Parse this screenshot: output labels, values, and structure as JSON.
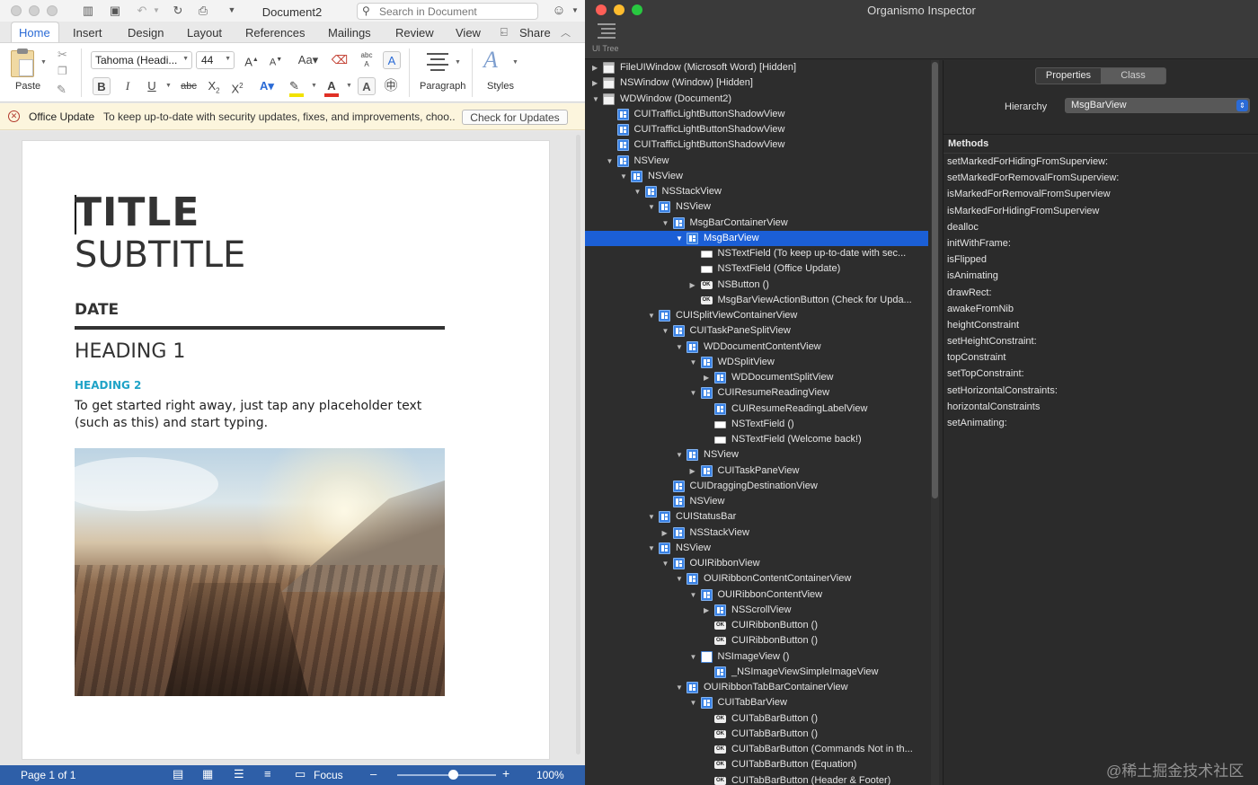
{
  "word": {
    "document_title": "Document2",
    "search_placeholder": "Search in Document",
    "share_label": "Share",
    "tabs": [
      "Home",
      "Insert",
      "Design",
      "Layout",
      "References",
      "Mailings",
      "Review",
      "View"
    ],
    "ribbon": {
      "paste": "Paste",
      "font_name": "Tahoma (Headi...",
      "font_size": "44",
      "bold": "B",
      "italic": "I",
      "underline": "U",
      "strike": "abc",
      "subscript": "X2",
      "superscript": "X2",
      "paragraph": "Paragraph",
      "styles": "Styles"
    },
    "banner": {
      "title": "Office Update",
      "message": "To keep up-to-date with security updates, fixes, and improvements, choo...",
      "button": "Check for Updates"
    },
    "doc": {
      "title": "TITLE",
      "subtitle": "SUBTITLE",
      "date": "DATE",
      "heading1": "HEADING 1",
      "heading2": "HEADING 2",
      "body": "To get started right away, just tap any placeholder text (such as this) and start typing."
    },
    "status": {
      "page": "Page 1 of 1",
      "focus": "Focus",
      "zoom": "100%",
      "zoom_level": 0.56
    }
  },
  "inspector": {
    "title": "Organismo Inspector",
    "ui_tree_label": "UI Tree",
    "tree": [
      {
        "d": 0,
        "exp": "right",
        "icon": "win",
        "label": "FileUIWindow (Microsoft Word) [Hidden]"
      },
      {
        "d": 0,
        "exp": "right",
        "icon": "win",
        "label": "NSWindow (Window) [Hidden]"
      },
      {
        "d": 0,
        "exp": "down",
        "icon": "win",
        "label": "WDWindow (Document2)"
      },
      {
        "d": 1,
        "exp": "",
        "icon": "view",
        "label": "CUITrafficLightButtonShadowView"
      },
      {
        "d": 1,
        "exp": "",
        "icon": "view",
        "label": "CUITrafficLightButtonShadowView"
      },
      {
        "d": 1,
        "exp": "",
        "icon": "view",
        "label": "CUITrafficLightButtonShadowView"
      },
      {
        "d": 1,
        "exp": "down",
        "icon": "view",
        "label": "NSView"
      },
      {
        "d": 2,
        "exp": "down",
        "icon": "view",
        "label": "NSView"
      },
      {
        "d": 3,
        "exp": "down",
        "icon": "view",
        "label": "NSStackView"
      },
      {
        "d": 4,
        "exp": "down",
        "icon": "view",
        "label": "NSView"
      },
      {
        "d": 5,
        "exp": "down",
        "icon": "view",
        "label": "MsgBarContainerView"
      },
      {
        "d": 6,
        "exp": "down",
        "icon": "view",
        "label": "MsgBarView",
        "sel": true
      },
      {
        "d": 7,
        "exp": "",
        "icon": "field",
        "label": "NSTextField (To keep up-to-date with sec..."
      },
      {
        "d": 7,
        "exp": "",
        "icon": "field",
        "label": "NSTextField (Office Update)"
      },
      {
        "d": 7,
        "exp": "right",
        "icon": "btn",
        "label": "NSButton ()"
      },
      {
        "d": 7,
        "exp": "",
        "icon": "btn",
        "label": "MsgBarViewActionButton (Check for Upda..."
      },
      {
        "d": 4,
        "exp": "down",
        "icon": "view",
        "label": "CUISplitViewContainerView"
      },
      {
        "d": 5,
        "exp": "down",
        "icon": "view",
        "label": "CUITaskPaneSplitView"
      },
      {
        "d": 6,
        "exp": "down",
        "icon": "view",
        "label": "WDDocumentContentView"
      },
      {
        "d": 7,
        "exp": "down",
        "icon": "view",
        "label": "WDSplitView"
      },
      {
        "d": 8,
        "exp": "right",
        "icon": "view",
        "label": "WDDocumentSplitView"
      },
      {
        "d": 7,
        "exp": "down",
        "icon": "view",
        "label": "CUIResumeReadingView"
      },
      {
        "d": 8,
        "exp": "",
        "icon": "view",
        "label": "CUIResumeReadingLabelView"
      },
      {
        "d": 8,
        "exp": "",
        "icon": "field",
        "label": "NSTextField ()"
      },
      {
        "d": 8,
        "exp": "",
        "icon": "field",
        "label": "NSTextField (Welcome back!)"
      },
      {
        "d": 6,
        "exp": "down",
        "icon": "view",
        "label": "NSView"
      },
      {
        "d": 7,
        "exp": "right",
        "icon": "view",
        "label": "CUITaskPaneView"
      },
      {
        "d": 5,
        "exp": "",
        "icon": "view",
        "label": "CUIDraggingDestinationView"
      },
      {
        "d": 5,
        "exp": "",
        "icon": "view",
        "label": "NSView"
      },
      {
        "d": 4,
        "exp": "down",
        "icon": "view",
        "label": "CUIStatusBar"
      },
      {
        "d": 5,
        "exp": "right",
        "icon": "view",
        "label": "NSStackView"
      },
      {
        "d": 4,
        "exp": "down",
        "icon": "view",
        "label": "NSView"
      },
      {
        "d": 5,
        "exp": "down",
        "icon": "view",
        "label": "OUIRibbonView"
      },
      {
        "d": 6,
        "exp": "down",
        "icon": "view",
        "label": "OUIRibbonContentContainerView"
      },
      {
        "d": 7,
        "exp": "down",
        "icon": "view",
        "label": "OUIRibbonContentView"
      },
      {
        "d": 8,
        "exp": "right",
        "icon": "view",
        "label": "NSScrollView"
      },
      {
        "d": 8,
        "exp": "",
        "icon": "btn",
        "label": "CUIRibbonButton ()"
      },
      {
        "d": 8,
        "exp": "",
        "icon": "btn",
        "label": "CUIRibbonButton ()"
      },
      {
        "d": 7,
        "exp": "down",
        "icon": "img",
        "label": "NSImageView ()"
      },
      {
        "d": 8,
        "exp": "",
        "icon": "view",
        "label": "_NSImageViewSimpleImageView"
      },
      {
        "d": 6,
        "exp": "down",
        "icon": "view",
        "label": "OUIRibbonTabBarContainerView"
      },
      {
        "d": 7,
        "exp": "down",
        "icon": "view",
        "label": "CUITabBarView"
      },
      {
        "d": 8,
        "exp": "",
        "icon": "btn",
        "label": "CUITabBarButton ()"
      },
      {
        "d": 8,
        "exp": "",
        "icon": "btn",
        "label": "CUITabBarButton ()"
      },
      {
        "d": 8,
        "exp": "",
        "icon": "btn",
        "label": "CUITabBarButton (Commands Not in th..."
      },
      {
        "d": 8,
        "exp": "",
        "icon": "btn",
        "label": "CUITabBarButton (Equation)"
      },
      {
        "d": 8,
        "exp": "",
        "icon": "btn",
        "label": "CUITabBarButton (Header & Footer)"
      }
    ],
    "seg_properties": "Properties",
    "seg_class": "Class",
    "hierarchy_label": "Hierarchy",
    "hierarchy_value": "MsgBarView",
    "methods_header": "Methods",
    "methods": [
      "setMarkedForHidingFromSuperview:",
      "setMarkedForRemovalFromSuperview:",
      "isMarkedForRemovalFromSuperview",
      "isMarkedForHidingFromSuperview",
      "dealloc",
      "initWithFrame:",
      "isFlipped",
      "isAnimating",
      "drawRect:",
      "awakeFromNib",
      "heightConstraint",
      "setHeightConstraint:",
      "topConstraint",
      "setTopConstraint:",
      "setHorizontalConstraints:",
      "horizontalConstraints",
      "setAnimating:"
    ]
  },
  "watermark": "@稀土掘金技术社区",
  "colors": {
    "selection": "#1b5fd6",
    "heading2": "#1fa3c7",
    "status_bar": "#2e5fa8",
    "accent": "#2b6bd6"
  }
}
